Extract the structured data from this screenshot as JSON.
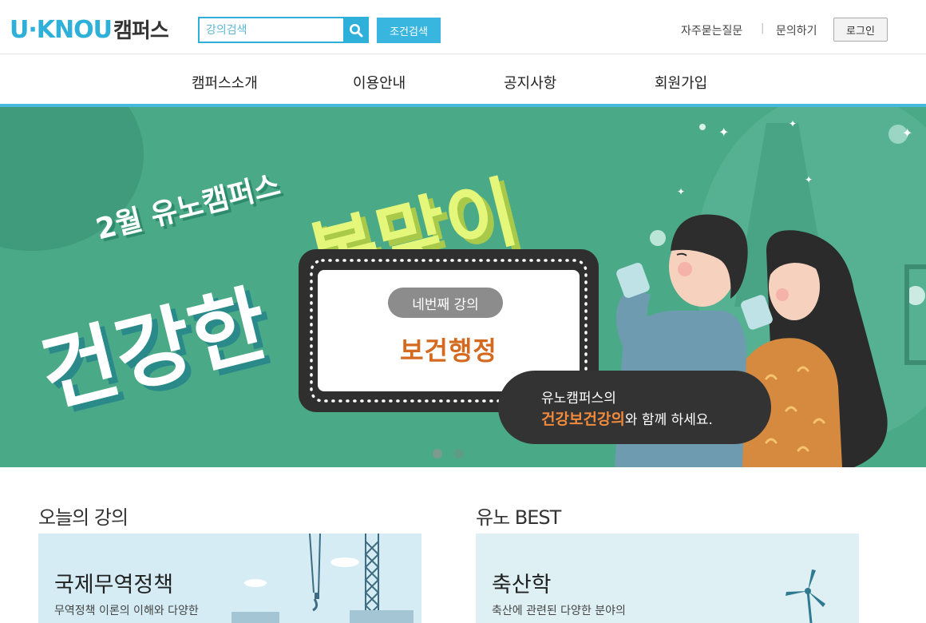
{
  "header": {
    "logo_main": "U·KNOU",
    "logo_sub": "캠퍼스",
    "search_placeholder": "강의검색",
    "cond_search_label": "조건검색",
    "faq_label": "자주묻는질문",
    "separator": "|",
    "inquiry_label": "문의하기",
    "login_label": "로그인"
  },
  "nav": {
    "items": [
      "캠퍼스소개",
      "이용안내",
      "공지사항",
      "회원가입"
    ]
  },
  "banner": {
    "subtitle": "2월 유노캠퍼스",
    "title_left": "건강한",
    "title_right": "봄맞이",
    "lecture_order": "네번째 강의",
    "lecture_name": "보건행정",
    "speech_line1": "유노캠퍼스의",
    "speech_highlight": "건강보건강의",
    "speech_rest": "와 함께 하세요.",
    "colors": {
      "bg": "#4aaa87",
      "accent_yellow": "#e5f77a",
      "accent_orange": "#d36a1f"
    }
  },
  "sections": {
    "today": {
      "title": "오늘의 강의",
      "card_title": "국제무역정책",
      "card_desc": "무역정책 이론의 이해와 다양한"
    },
    "best": {
      "title": "유노 BEST",
      "card_title": "축산학",
      "card_desc": "축산에 관련된 다양한 분야의"
    }
  }
}
